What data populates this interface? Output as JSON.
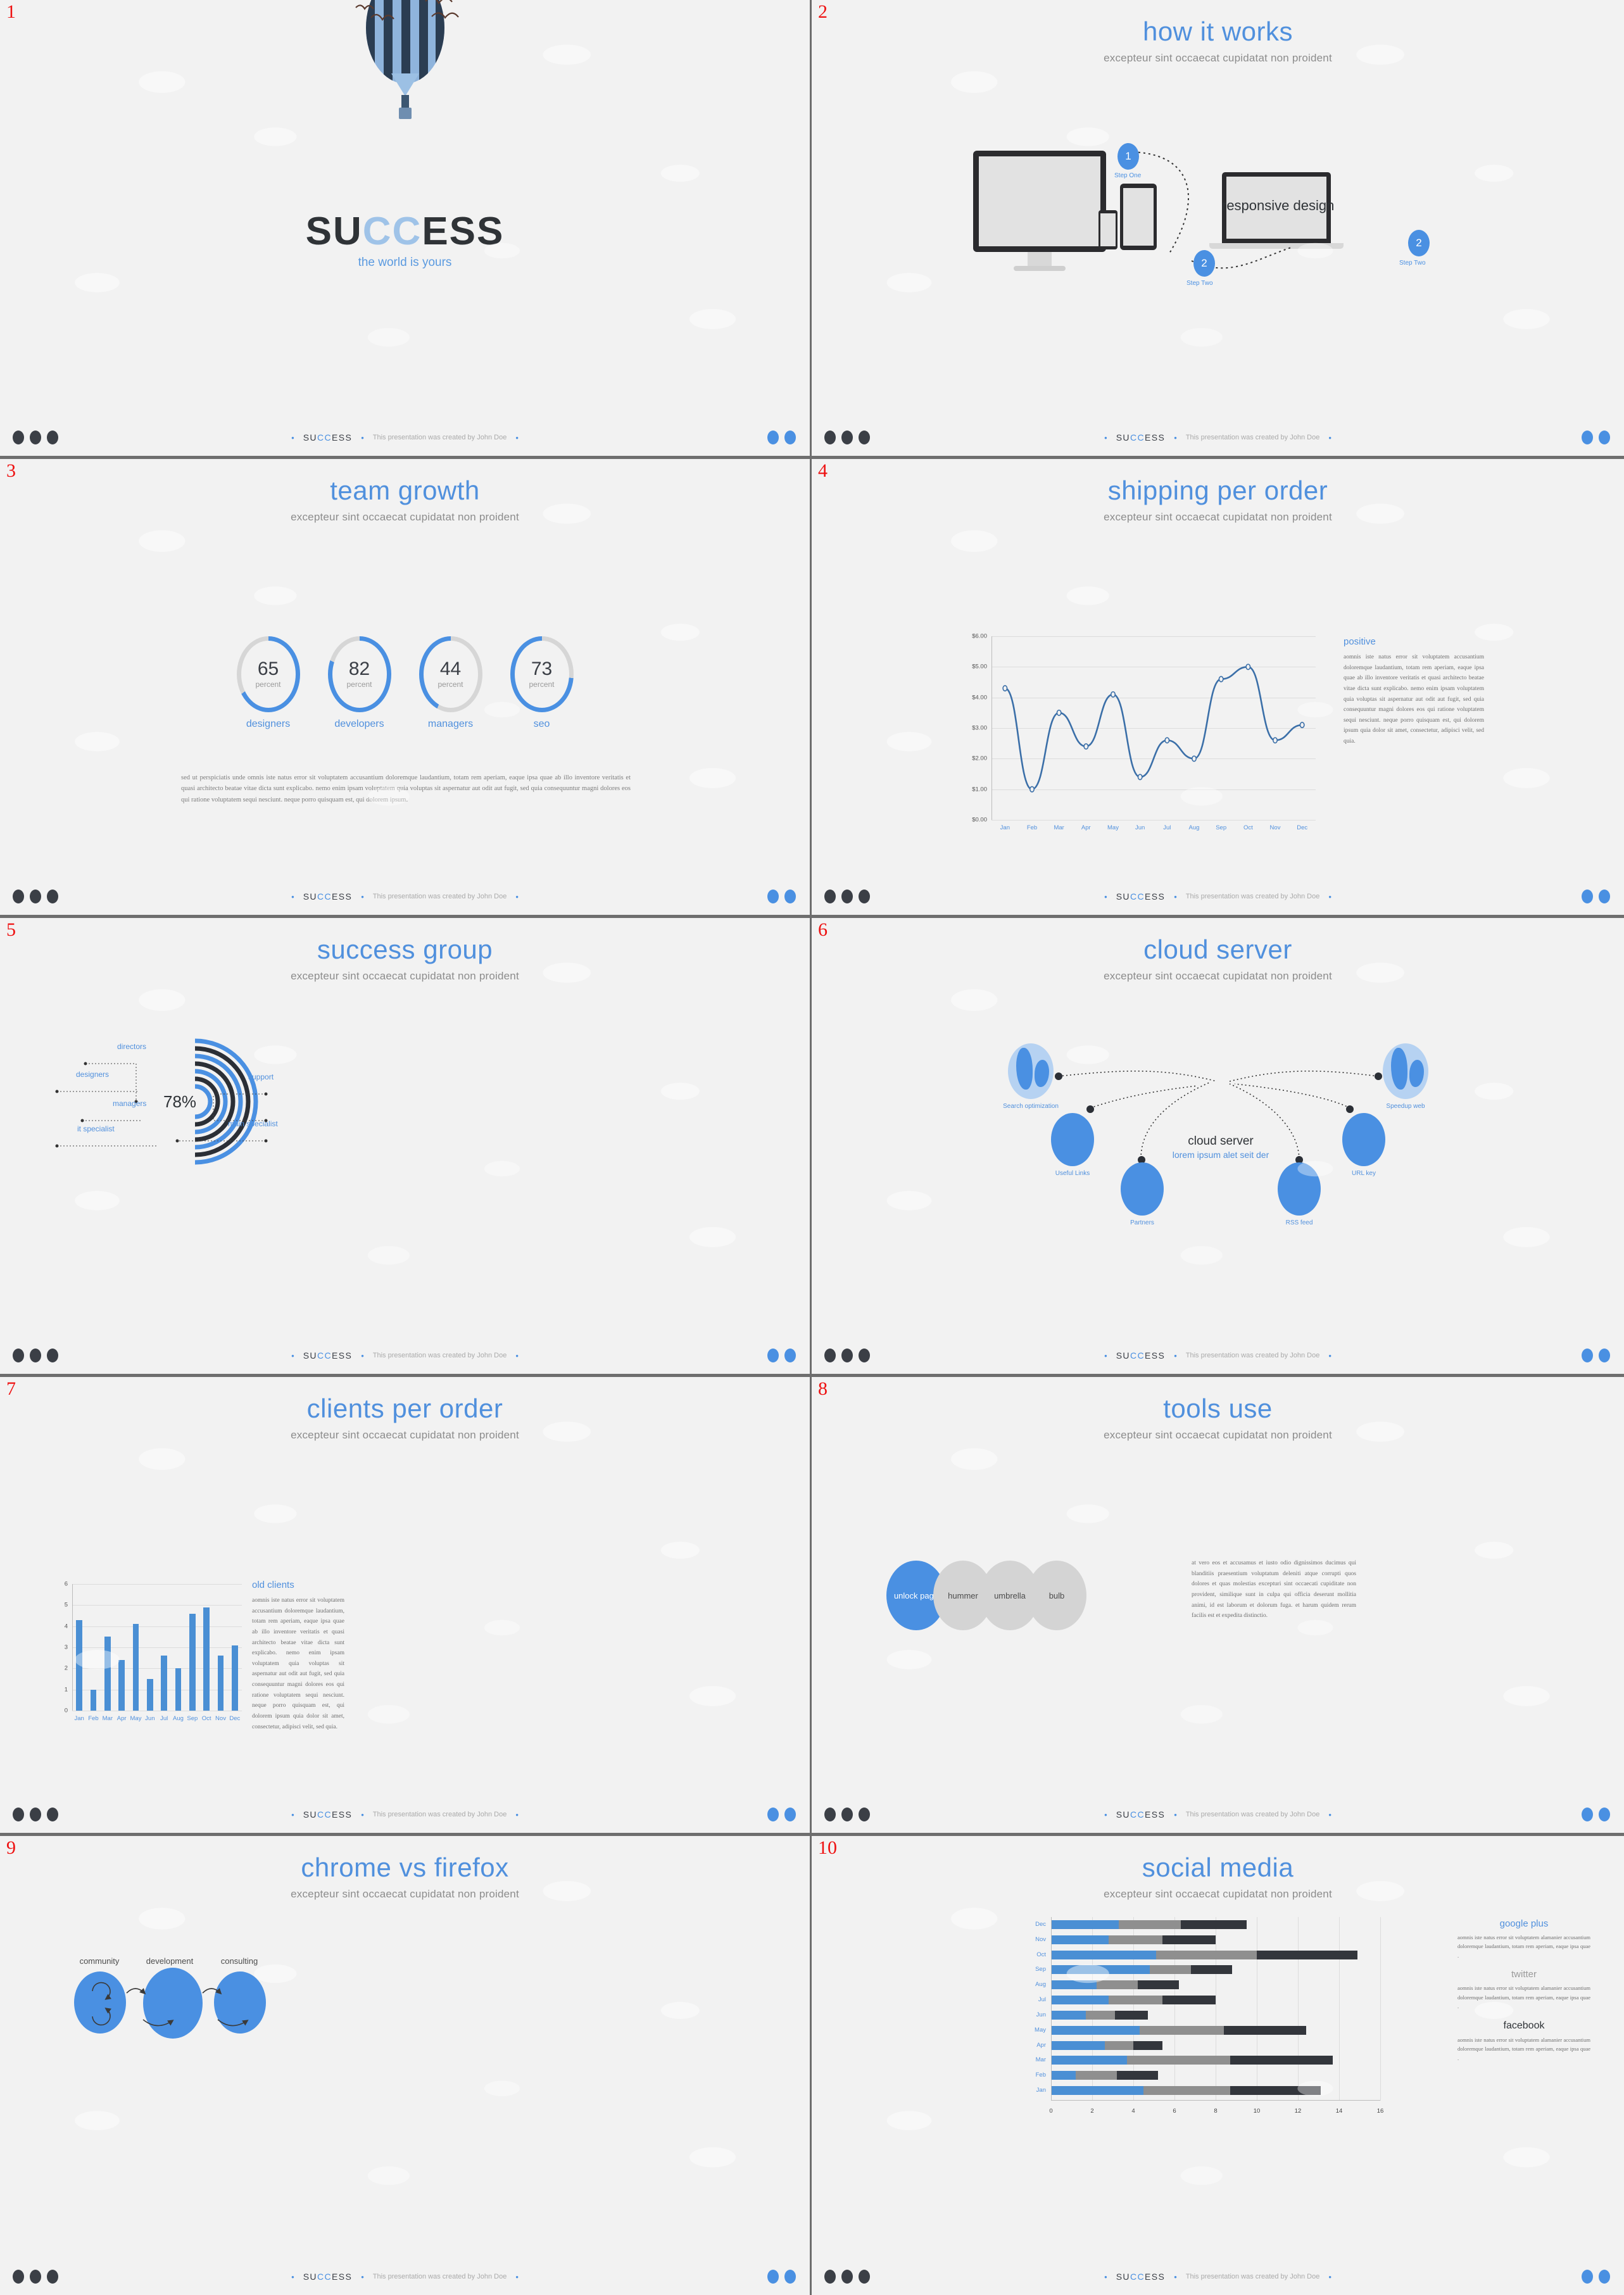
{
  "brand": {
    "name_prefix": "SU",
    "name_accent": "CC",
    "name_suffix": "ESS",
    "footer_note": "This presentation was created by John Doe",
    "bullet": "•",
    "accent": "#4a90e2",
    "title_color": "#5090dd",
    "dark": "#3b3f46"
  },
  "common": {
    "subtitle": "excepteur sint occaecat cupidatat non proident"
  },
  "slides": [
    {
      "number": "1",
      "title": "SUCCESS",
      "title_left": "SU",
      "title_mid": "CC",
      "title_right": "ESS",
      "tagline": "the world is yours"
    },
    {
      "number": "2",
      "title": "how it works",
      "responsive_label": "responsive design",
      "steps": [
        {
          "num": "1",
          "label": "Step One"
        },
        {
          "num": "2",
          "label": "Step Two"
        },
        {
          "num": "2",
          "label": "Step Two"
        }
      ]
    },
    {
      "number": "3",
      "title": "team growth",
      "unit": "percent",
      "body": "sed ut perspiciatis unde omnis iste natus error sit voluptatem accusantium doloremque laudantium, totam rem aperiam, eaque ipsa quae ab illo inventore veritatis et quasi architecto beatae vitae dicta sunt explicabo. nemo enim ipsam voluptatem quia voluptas sit aspernatur aut odit aut fugit, sed quia consequuntur magni dolores eos qui ratione voluptatem sequi nesciunt. neque porro quisquam est, qui dolorem ipsum."
    },
    {
      "number": "4",
      "title": "shipping per order",
      "side_head": "positive",
      "side_body": "aomnis iste natus error sit voluptatem accusantium doloremque laudantium, totam rem aperiam, eaque ipsa quae ab illo inventore veritatis et quasi architecto beatae vitae dicta sunt explicabo. nemo enim ipsam voluptatem quia voluptas sit aspernatur aut odit aut fugit, sed quia consequuntur magni dolores eos qui ratione voluptatem sequi nesciunt. neque porro quisquam est, qui dolorem ipsum quia dolor sit amet, consectetur, adipisci velit, sed quia."
    },
    {
      "number": "5",
      "title": "success group",
      "center_value": "78%",
      "labels_left": [
        "directors",
        "designers",
        "managers",
        "it specialist"
      ],
      "labels_right": [
        "support",
        "main specialist"
      ]
    },
    {
      "number": "6",
      "title": "cloud server",
      "center_title": "cloud server",
      "center_sub": "lorem ipsum alet seit der",
      "nodes": [
        "Search optimization",
        "Speedup web",
        "Useful Links",
        "URL key",
        "Partners",
        "RSS feed"
      ]
    },
    {
      "number": "7",
      "title": "clients per order",
      "side_head": "old clients",
      "side_body": "aomnis iste natus error sit voluptatem accusantium doloremque laudantium, totam rem aperiam, eaque ipsa quae ab illo inventore veritatis et quasi architecto beatae vitae dicta sunt explicabo. nemo enim ipsam voluptatem quia voluptas sit aspernatur aut odit aut fugit, sed quia consequuntur magni dolores eos qui ratione voluptatem sequi nesciunt. neque porro quisquam est, qui dolorem ipsum quia dolor sit amet, consectetur, adipisci velit, sed quia."
    },
    {
      "number": "8",
      "title": "tools use",
      "circles": [
        "unlock page",
        "hummer",
        "umbrella",
        "bulb"
      ],
      "body": "at vero eos et accusamus et iusto odio dignissimos ducimus qui blanditiis praesentium voluptatum deleniti atque corrupti quos dolores et quas molestias excepturi sint occaecati cupiditate non provident, similique sunt in culpa qui officia deserunt mollitia animi, id est laborum et dolorum fuga. et harum quidem rerum facilis est et expedita distinctio."
    },
    {
      "number": "9",
      "title": "chrome vs firefox",
      "labels": [
        "community",
        "development",
        "consulting"
      ]
    },
    {
      "number": "10",
      "title": "social media",
      "sections": [
        {
          "head": "google plus",
          "body": "aomnis iste natus error sit voluptatem alamanier accusantium doloremque laudantium, totam rem aperiam, eaque ipsa quae ."
        },
        {
          "head": "twitter",
          "body": "aomnis iste natus error sit voluptatem alamanier accusantium doloremque laudantium, totam rem aperiam, eaque ipsa quae ."
        },
        {
          "head": "facebook",
          "body": "aomnis iste natus error sit voluptatem alamanier accusantium doloremque laudantium, totam rem aperiam, eaque ipsa quae ."
        }
      ]
    }
  ],
  "chart_data": [
    {
      "type": "pie",
      "title": "team growth",
      "slide": 3,
      "categories": [
        "designers",
        "developers",
        "managers",
        "seo"
      ],
      "values": [
        65,
        82,
        44,
        73
      ],
      "unit": "percent",
      "colors": [
        "#4a90e2",
        "#4a90e2",
        "#4a90e2",
        "#4a90e2"
      ],
      "track_color": "#d6d6d6"
    },
    {
      "type": "line",
      "title": "shipping per order",
      "slide": 4,
      "categories": [
        "Jan",
        "Feb",
        "Mar",
        "Apr",
        "May",
        "Jun",
        "Jul",
        "Aug",
        "Sep",
        "Oct",
        "Nov",
        "Dec"
      ],
      "values": [
        4.3,
        1.0,
        3.5,
        2.4,
        4.1,
        1.4,
        2.6,
        2.0,
        4.6,
        5.0,
        2.6,
        3.1
      ],
      "ytick_labels": [
        "$0.00",
        "$1.00",
        "$2.00",
        "$3.00",
        "$4.00",
        "$5.00",
        "$6.00"
      ],
      "ylim": [
        0,
        6
      ],
      "xlabel": "",
      "ylabel": "",
      "grid": true,
      "legend": "none",
      "series_color": "#3b6fa8",
      "marker": "open-circle"
    },
    {
      "type": "pie",
      "title": "success group",
      "slide": 5,
      "center_value": "78%",
      "categories": [
        "directors",
        "designers",
        "managers",
        "it specialist",
        "support",
        "main specialist"
      ],
      "values": [
        78
      ],
      "colors": [
        "#4a90e2",
        "#2b2f36"
      ]
    },
    {
      "type": "bar",
      "title": "clients per order",
      "slide": 7,
      "categories": [
        "Jan",
        "Feb",
        "Mar",
        "Apr",
        "May",
        "Jun",
        "Jul",
        "Aug",
        "Sep",
        "Oct",
        "Nov",
        "Dec"
      ],
      "values": [
        4.3,
        1.0,
        3.5,
        2.4,
        4.1,
        1.5,
        2.6,
        2.0,
        4.6,
        4.9,
        2.6,
        3.1
      ],
      "ytick_labels": [
        "0",
        "1",
        "2",
        "3",
        "4",
        "5",
        "6"
      ],
      "ylim": [
        0,
        6
      ],
      "xlabel": "",
      "ylabel": "",
      "grid": true,
      "legend": "none",
      "series_color": "#4a8fd4"
    },
    {
      "type": "bar",
      "title": "social media",
      "slide": 10,
      "orientation": "horizontal",
      "categories": [
        "Jan",
        "Feb",
        "Mar",
        "Apr",
        "May",
        "Jun",
        "Jul",
        "Aug",
        "Sep",
        "Oct",
        "Nov",
        "Dec"
      ],
      "series": [
        {
          "name": "google plus",
          "color": "#4a8fd4",
          "values": [
            4.5,
            1.2,
            3.7,
            2.6,
            4.3,
            1.7,
            2.8,
            2.2,
            4.8,
            5.1,
            2.8,
            3.3
          ]
        },
        {
          "name": "twitter",
          "color": "#8f8f8f",
          "values": [
            4.2,
            2.0,
            5.0,
            1.4,
            4.1,
            1.4,
            2.6,
            2.0,
            2.0,
            4.9,
            2.6,
            3.0
          ]
        },
        {
          "name": "facebook",
          "color": "#33363c",
          "values": [
            4.4,
            2.0,
            5.0,
            1.4,
            4.0,
            1.6,
            2.6,
            2.0,
            2.0,
            4.9,
            2.6,
            3.2
          ]
        }
      ],
      "xtick_labels": [
        "0",
        "2",
        "4",
        "6",
        "8",
        "10",
        "12",
        "14",
        "16"
      ],
      "xlim": [
        0,
        16
      ],
      "grid": true,
      "legend": "right"
    }
  ]
}
